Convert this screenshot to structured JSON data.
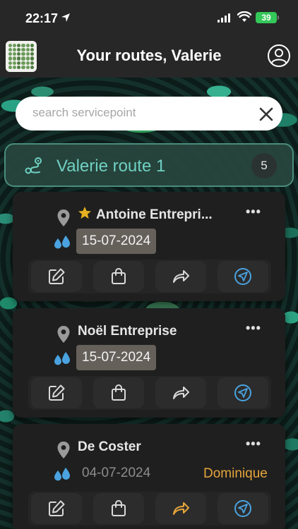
{
  "status_bar": {
    "time": "22:17",
    "battery": "39"
  },
  "header": {
    "title": "Your routes, Valerie"
  },
  "search": {
    "placeholder": "search servicepoint"
  },
  "route": {
    "name": "Valerie route 1",
    "count": "5"
  },
  "cards": [
    {
      "name": "Antoine Entrepri...",
      "starred": true,
      "date": "15-07-2024",
      "date_highlighted": true,
      "assignee": "",
      "menu": "•••",
      "forward_color": "#d9d9d9"
    },
    {
      "name": "Noël Entreprise",
      "starred": false,
      "date": "15-07-2024",
      "date_highlighted": true,
      "assignee": "",
      "menu": "•••",
      "forward_color": "#d9d9d9"
    },
    {
      "name": "De Coster",
      "starred": false,
      "date": "04-07-2024",
      "date_highlighted": false,
      "assignee": "Dominique",
      "menu": "•••",
      "forward_color": "#e6a53c"
    }
  ],
  "icons": {
    "actions": [
      "edit-icon",
      "bag-icon",
      "forward-icon",
      "navigate-icon"
    ]
  },
  "colors": {
    "accent": "#6fd0c3",
    "navigate": "#4aa3e0",
    "drop": "#4aa3e0",
    "star": "#e6b020",
    "assignee": "#e6a53c"
  }
}
